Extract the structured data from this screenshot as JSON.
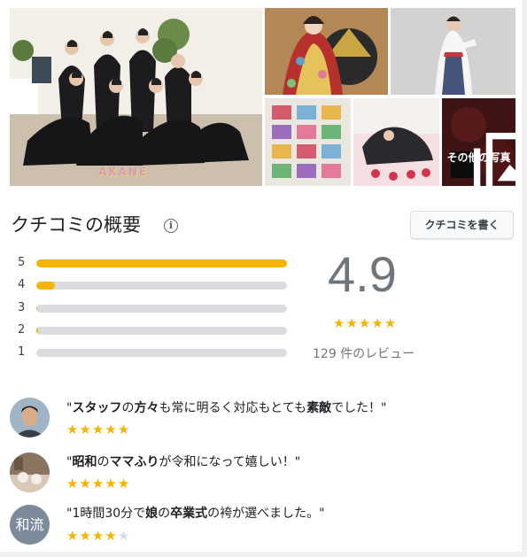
{
  "photos": {
    "main_logo_text": "AKANE",
    "more_label": "その他の写真"
  },
  "summary": {
    "title": "クチコミの概要",
    "info_glyph": "i",
    "write_review": "クチコミを書く",
    "rating": "4.9",
    "stars": 5,
    "count_text": "129 件のレビュー",
    "histogram": [
      {
        "label": "5",
        "fraction": 1.0
      },
      {
        "label": "4",
        "fraction": 0.075
      },
      {
        "label": "3",
        "fraction": 0.005
      },
      {
        "label": "2",
        "fraction": 0.008
      },
      {
        "label": "1",
        "fraction": 0.0
      }
    ]
  },
  "reviews": [
    {
      "avatar_type": "photo-man",
      "stars": 5,
      "parts": [
        {
          "t": "\"",
          "b": false
        },
        {
          "t": "スタッフ",
          "b": true
        },
        {
          "t": "の",
          "b": false
        },
        {
          "t": "方々",
          "b": true
        },
        {
          "t": "も常に明るく対応もとても",
          "b": false
        },
        {
          "t": "素敵",
          "b": true
        },
        {
          "t": "でした！\"",
          "b": false
        }
      ]
    },
    {
      "avatar_type": "photo-cafe",
      "stars": 5,
      "parts": [
        {
          "t": "\"",
          "b": false
        },
        {
          "t": "昭和",
          "b": true
        },
        {
          "t": "の",
          "b": false
        },
        {
          "t": "ママふり",
          "b": true
        },
        {
          "t": "が令和になって嬉しい！\"",
          "b": false
        }
      ]
    },
    {
      "avatar_type": "text",
      "avatar_text": "和流",
      "stars": 4,
      "parts": [
        {
          "t": "\"1時間30分で",
          "b": false
        },
        {
          "t": "娘",
          "b": true
        },
        {
          "t": "の",
          "b": false
        },
        {
          "t": "卒業式",
          "b": true
        },
        {
          "t": "の袴が選べました。\"",
          "b": false
        }
      ]
    }
  ],
  "colors": {
    "star": "#f4b400",
    "star_off": "#dadce0",
    "bar_track": "#dadce0",
    "rating_text": "#70757a"
  }
}
